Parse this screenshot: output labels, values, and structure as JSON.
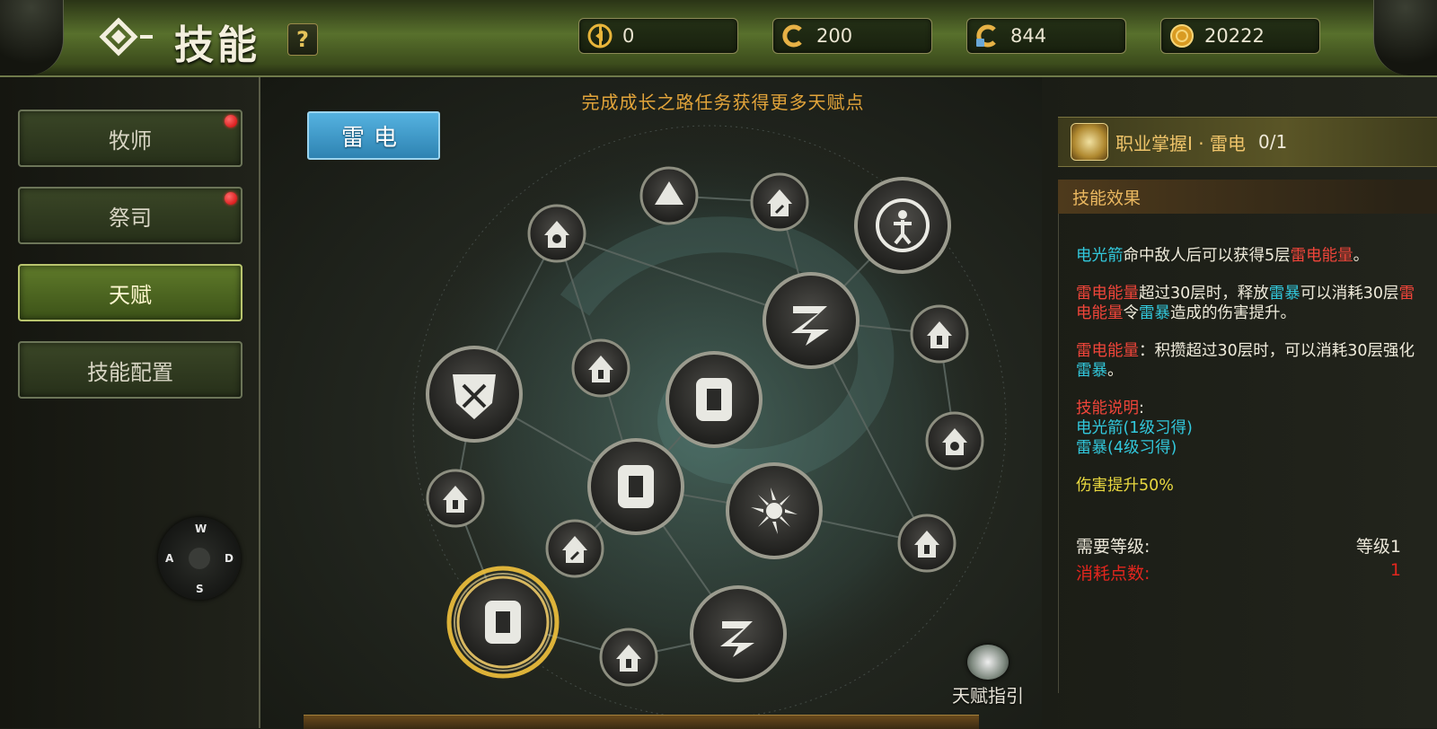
{
  "header": {
    "title": "技能",
    "help_label": "?",
    "currencies": [
      {
        "icon": "pointer-coin-icon",
        "value": "0"
      },
      {
        "icon": "copper-coin-icon",
        "value": "200"
      },
      {
        "icon": "locked-coin-icon",
        "value": "844"
      },
      {
        "icon": "gold-coin-icon",
        "value": "20222"
      }
    ]
  },
  "sidebar": {
    "items": [
      {
        "label": "牧师",
        "badge": true
      },
      {
        "label": "祭司",
        "badge": true
      },
      {
        "label": "天赋",
        "active": true
      },
      {
        "label": "技能配置"
      }
    ]
  },
  "dpad": {
    "up": "W",
    "left": "A",
    "right": "D",
    "down": "S"
  },
  "tree": {
    "hint": "完成成长之路任务获得更多天赋点",
    "school_tab": "雷电",
    "guide_label": "天赋指引",
    "nodes": [
      {
        "id": "n1",
        "icon": "shield-lightning-icon",
        "size": "large"
      },
      {
        "id": "n2",
        "icon": "lightning-bolt-icon",
        "size": "large"
      },
      {
        "id": "n3",
        "icon": "scroll-icon",
        "size": "large"
      },
      {
        "id": "n4",
        "icon": "scroll-icon",
        "size": "large"
      },
      {
        "id": "n5",
        "icon": "burst-icon",
        "size": "large"
      },
      {
        "id": "n6",
        "icon": "lightning-bolt-icon",
        "size": "large"
      },
      {
        "id": "n7",
        "icon": "figure-cycle-icon",
        "size": "large"
      },
      {
        "id": "n8",
        "icon": "scroll-icon",
        "size": "large",
        "selected": true
      }
    ]
  },
  "skill_panel": {
    "icon": "scroll-icon",
    "name": "职业掌握Ⅰ · 雷电",
    "level": "0/1",
    "effect_header": "技能效果",
    "effect_lines": {
      "p1": [
        "电光箭",
        "命中敌人后可以获得5层",
        "雷电能量",
        "。"
      ],
      "p2": [
        "雷电能量",
        "超过30层时，释放",
        "雷暴",
        "可以消耗30层",
        "雷电能量",
        "令",
        "雷暴",
        "造成的伤害提升。"
      ],
      "p3": [
        "雷电能量",
        "：积攒超过30层时，可以消耗30层强化",
        "雷暴",
        "。"
      ],
      "p4_title": "技能说明",
      "p4_colon": ":",
      "p4_l1": "电光箭(1级习得)",
      "p4_l2": "雷暴(4级习得)",
      "p5": "伤害提升50%"
    },
    "req_label": "需要等级:",
    "req_value": "等级1",
    "cost_label": "消耗点数:",
    "cost_value": "1"
  },
  "colors": {
    "accent_green": "#58702c",
    "highlight_cyan": "#32c8dc",
    "highlight_red": "#f0453a",
    "highlight_yellow": "#e8d840",
    "selected_ring": "#f2c23c"
  }
}
